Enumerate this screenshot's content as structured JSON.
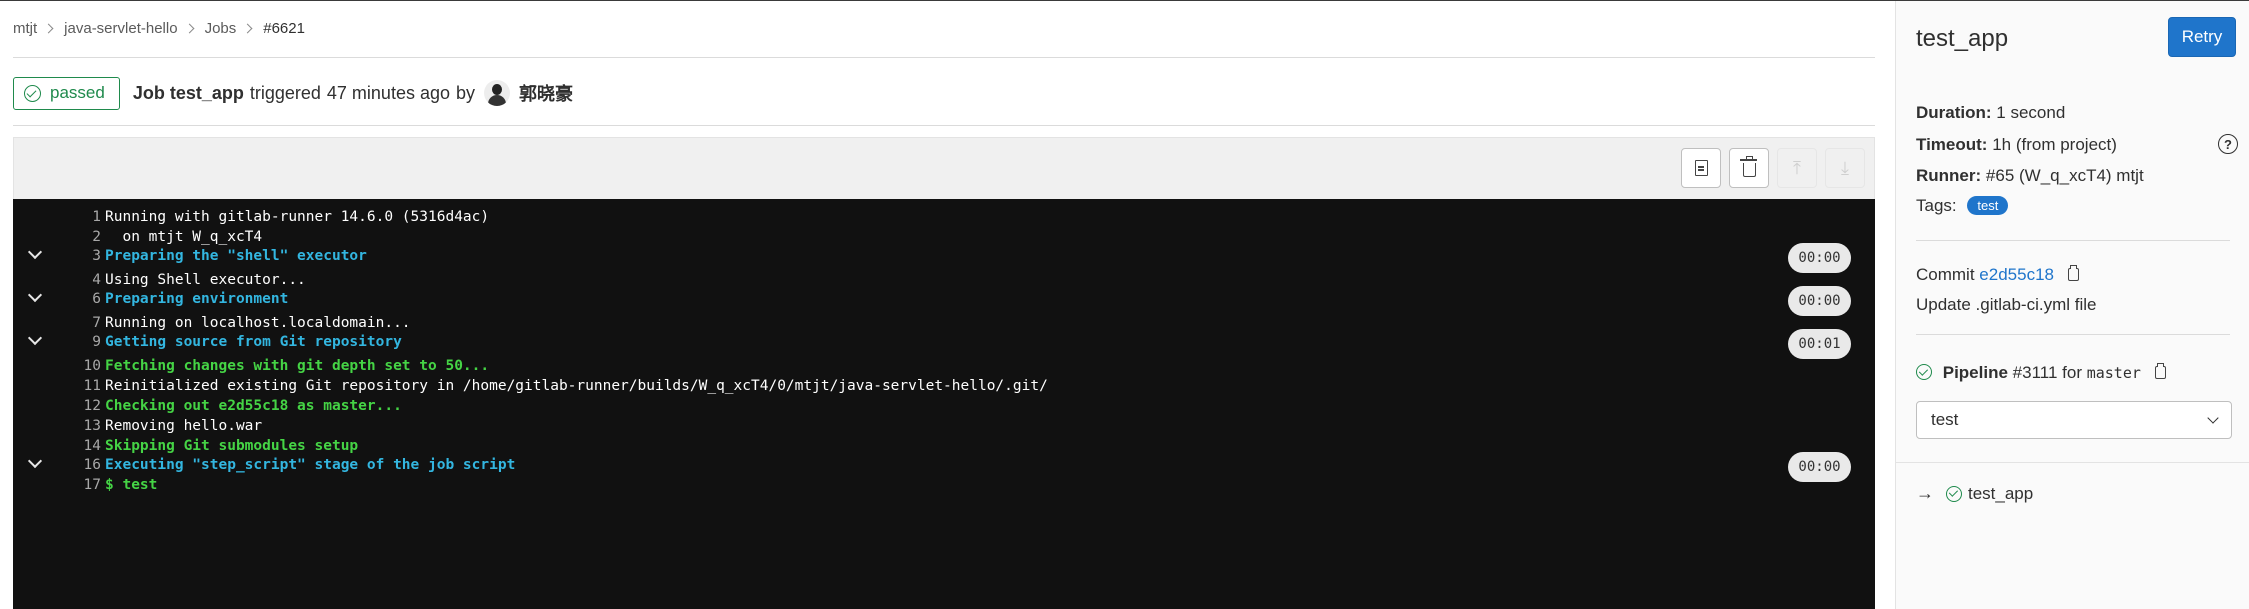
{
  "breadcrumb": {
    "items": [
      "mtjt",
      "java-servlet-hello",
      "Jobs",
      "#6621"
    ]
  },
  "job": {
    "status": "passed",
    "title": "Job test_app",
    "triggered_text": "triggered",
    "time": "47 minutes ago",
    "by_text": "by",
    "user": "郭晓豪"
  },
  "log": {
    "lines": [
      {
        "num": "1",
        "text": "Running with gitlab-runner 14.6.0 (5316d4ac)",
        "style": "normal",
        "section": false,
        "duration": ""
      },
      {
        "num": "2",
        "text": "  on mtjt W_q_xcT4",
        "style": "normal",
        "section": false,
        "duration": ""
      },
      {
        "num": "3",
        "text": "Preparing the \"shell\" executor",
        "style": "section",
        "section": true,
        "duration": "00:00"
      },
      {
        "num": "4",
        "text": "Using Shell executor...",
        "style": "normal",
        "section": false,
        "duration": ""
      },
      {
        "num": "6",
        "text": "Preparing environment",
        "style": "section",
        "section": true,
        "duration": "00:00"
      },
      {
        "num": "7",
        "text": "Running on localhost.localdomain...",
        "style": "normal",
        "section": false,
        "duration": ""
      },
      {
        "num": "9",
        "text": "Getting source from Git repository",
        "style": "section",
        "section": true,
        "duration": "00:01"
      },
      {
        "num": "10",
        "text": "Fetching changes with git depth set to 50...",
        "style": "green",
        "section": false,
        "duration": ""
      },
      {
        "num": "11",
        "text": "Reinitialized existing Git repository in /home/gitlab-runner/builds/W_q_xcT4/0/mtjt/java-servlet-hello/.git/",
        "style": "normal",
        "section": false,
        "duration": ""
      },
      {
        "num": "12",
        "text": "Checking out e2d55c18 as master...",
        "style": "green",
        "section": false,
        "duration": ""
      },
      {
        "num": "13",
        "text": "Removing hello.war",
        "style": "normal",
        "section": false,
        "duration": ""
      },
      {
        "num": "14",
        "text": "Skipping Git submodules setup",
        "style": "green",
        "section": false,
        "duration": ""
      },
      {
        "num": "16",
        "text": "Executing \"step_script\" stage of the job script",
        "style": "section",
        "section": true,
        "duration": "00:00"
      },
      {
        "num": "17",
        "text": "$ test",
        "style": "green",
        "section": false,
        "duration": ""
      }
    ]
  },
  "sidebar": {
    "title": "test_app",
    "retry_label": "Retry",
    "duration_label": "Duration:",
    "duration_value": "1 second",
    "timeout_label": "Timeout:",
    "timeout_value": "1h (from project)",
    "runner_label": "Runner:",
    "runner_value": "#65 (W_q_xcT4) mtjt",
    "tags_label": "Tags:",
    "tag": "test",
    "commit_label": "Commit",
    "commit_sha": "e2d55c18",
    "commit_message": "Update .gitlab-ci.yml file",
    "pipeline_label": "Pipeline",
    "pipeline_id": "#3111",
    "pipeline_for": "for",
    "pipeline_ref": "master",
    "stage_selected": "test",
    "current_job": "test_app"
  }
}
